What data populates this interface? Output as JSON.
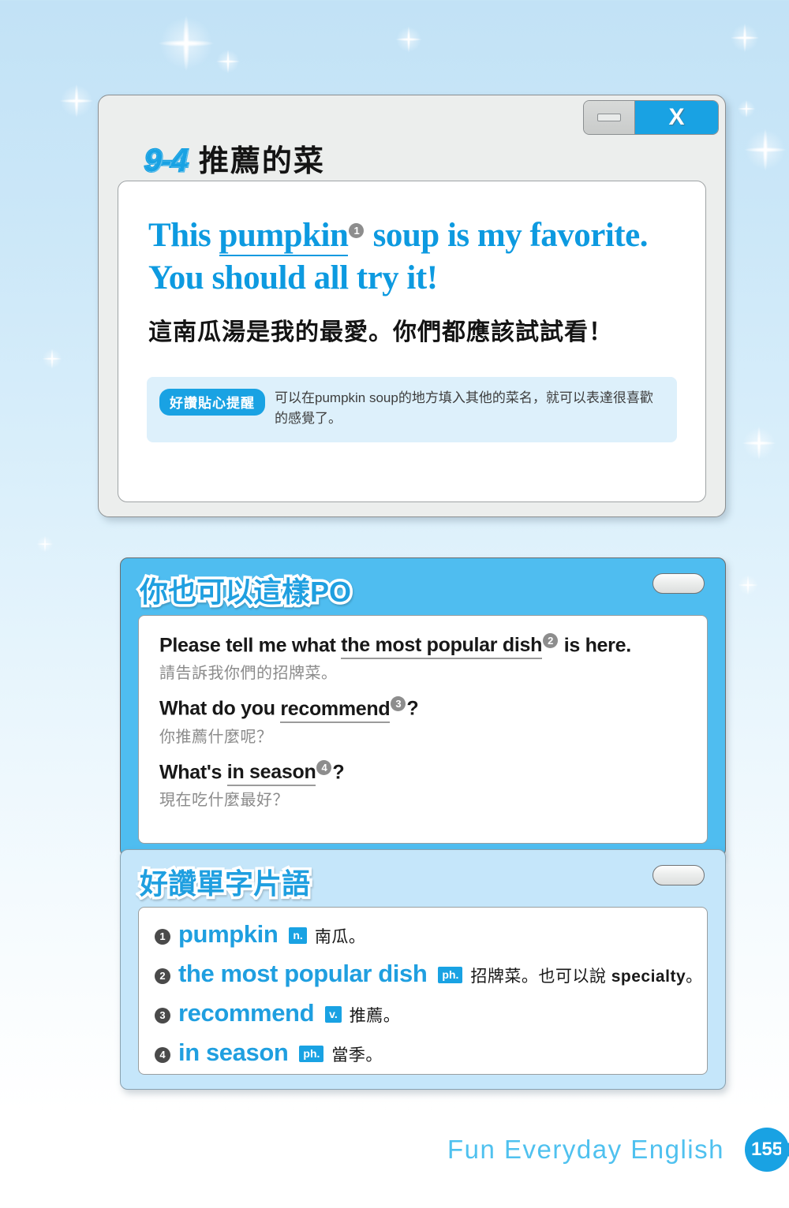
{
  "background": {
    "top_color": "#c2e2f6",
    "bottom_color": "#ffffff",
    "accent_blue": "#19a2e3"
  },
  "main_panel": {
    "window_controls": {
      "minimize_label": "",
      "close_label": "X"
    },
    "lesson_number": "9-4",
    "lesson_title": "推薦的菜",
    "sentence": {
      "english_prefix": "This ",
      "english_keyword": "pumpkin",
      "marker": "❶",
      "english_suffix": " soup is my favorite. You should all try it!",
      "chinese": "這南瓜湯是我的最愛。你們都應該試試看！"
    },
    "tip": {
      "label": "好讚貼心提醒",
      "text": "可以在pumpkin soup的地方填入其他的菜名，就可以表達很喜歡的感覺了。"
    }
  },
  "po_panel": {
    "title": "你也可以這樣PO",
    "sentences": [
      {
        "en_before": "Please tell me what ",
        "en_keyword": "the most popular dish",
        "marker": "❷",
        "en_after": " is here.",
        "zh": "請告訴我你們的招牌菜。"
      },
      {
        "en_before": "What do you ",
        "en_keyword": "recommend",
        "marker": "❸",
        "en_after": "?",
        "zh": "你推薦什麼呢？"
      },
      {
        "en_before": "What's ",
        "en_keyword": "in season",
        "marker": "❹",
        "en_after": "?",
        "zh": "現在吃什麼最好？"
      }
    ]
  },
  "vocab_panel": {
    "title": "好讚單字片語",
    "entries": [
      {
        "num": "❶",
        "word": "pumpkin",
        "pos": "n.",
        "definition": "南瓜。",
        "extra_label": "",
        "extra_word": "",
        "extra_tail": ""
      },
      {
        "num": "❷",
        "word": "the most popular dish",
        "pos": "ph.",
        "definition": "招牌菜。也可以說 ",
        "extra_label": "",
        "extra_word": "specialty",
        "extra_tail": "。"
      },
      {
        "num": "❸",
        "word": "recommend",
        "pos": "v.",
        "definition": "推薦。",
        "extra_label": "",
        "extra_word": "",
        "extra_tail": ""
      },
      {
        "num": "❹",
        "word": "in season",
        "pos": "ph.",
        "definition": "當季。",
        "extra_label": "",
        "extra_word": "",
        "extra_tail": ""
      }
    ]
  },
  "footer": {
    "brand": "Fun Everyday English",
    "page_number": "155"
  }
}
